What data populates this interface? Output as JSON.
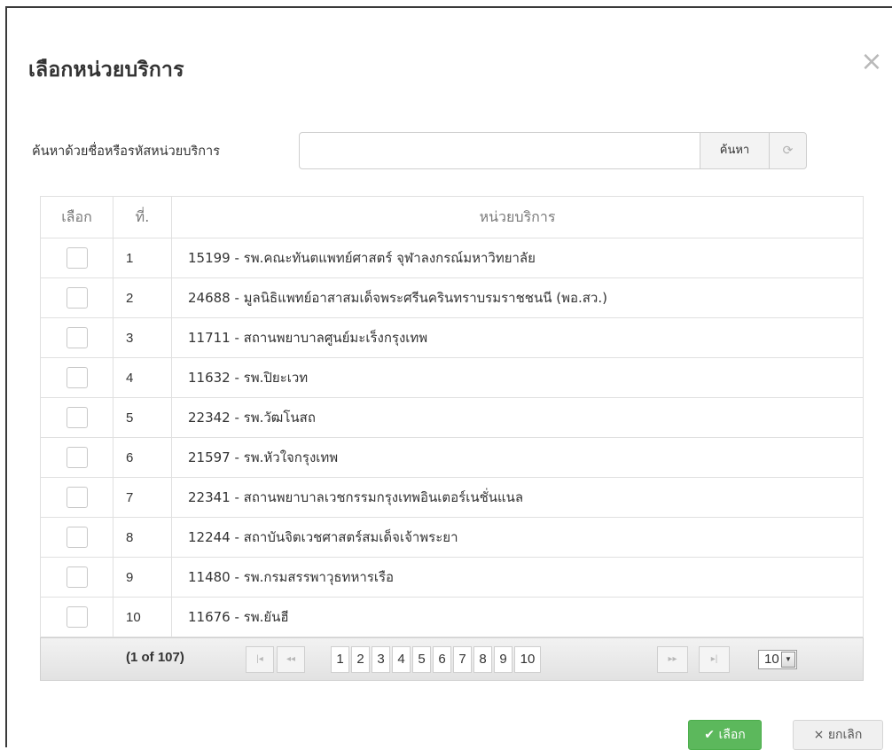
{
  "dialog": {
    "title": "เลือกหน่วยบริการ",
    "close_symbol": "×"
  },
  "search": {
    "label": "ค้นหาด้วยชื่อหรือรหัสหน่วยบริการ",
    "value": "",
    "placeholder": "",
    "search_button": "ค้นหา",
    "reset_icon": "refresh-icon"
  },
  "table": {
    "headers": [
      "เลือก",
      "ที่.",
      "หน่วยบริการ"
    ],
    "rows": [
      {
        "no": "1",
        "unit": "15199 - รพ.คณะทันตแพทย์ศาสตร์ จุฬาลงกรณ์มหาวิทยาลัย",
        "checked": false
      },
      {
        "no": "2",
        "unit": "24688 - มูลนิธิแพทย์อาสาสมเด็จพระศรีนครินทราบรมราชชนนี (พอ.สว.)",
        "checked": false
      },
      {
        "no": "3",
        "unit": "11711 - สถานพยาบาลศูนย์มะเร็งกรุงเทพ",
        "checked": false
      },
      {
        "no": "4",
        "unit": "11632 - รพ.ปิยะเวท",
        "checked": false
      },
      {
        "no": "5",
        "unit": "22342 - รพ.วัฒโนสถ",
        "checked": false
      },
      {
        "no": "6",
        "unit": "21597 - รพ.หัวใจกรุงเทพ",
        "checked": false
      },
      {
        "no": "7",
        "unit": "22341 - สถานพยาบาลเวชกรรมกรุงเทพอินเตอร์เนชั่นแนล",
        "checked": false
      },
      {
        "no": "8",
        "unit": "12244 - สถาบันจิตเวชศาสตร์สมเด็จเจ้าพระยา",
        "checked": false
      },
      {
        "no": "9",
        "unit": "11480 - รพ.กรมสรรพาวุธทหารเรือ",
        "checked": false
      },
      {
        "no": "10",
        "unit": "11676 - รพ.ยันฮี",
        "checked": false
      }
    ]
  },
  "pager": {
    "status": "(1 of 107)",
    "first_icon": "first-page-icon",
    "prev_icon": "prev-page-icon",
    "pages": [
      "1",
      "2",
      "3",
      "4",
      "5",
      "6",
      "7",
      "8",
      "9",
      "10"
    ],
    "next_icon": "next-page-icon",
    "last_icon": "last-page-icon",
    "rows_per_page": "10"
  },
  "footer": {
    "ok_label": "✔ เลือก",
    "cancel_label": "× ยกเลิก"
  }
}
